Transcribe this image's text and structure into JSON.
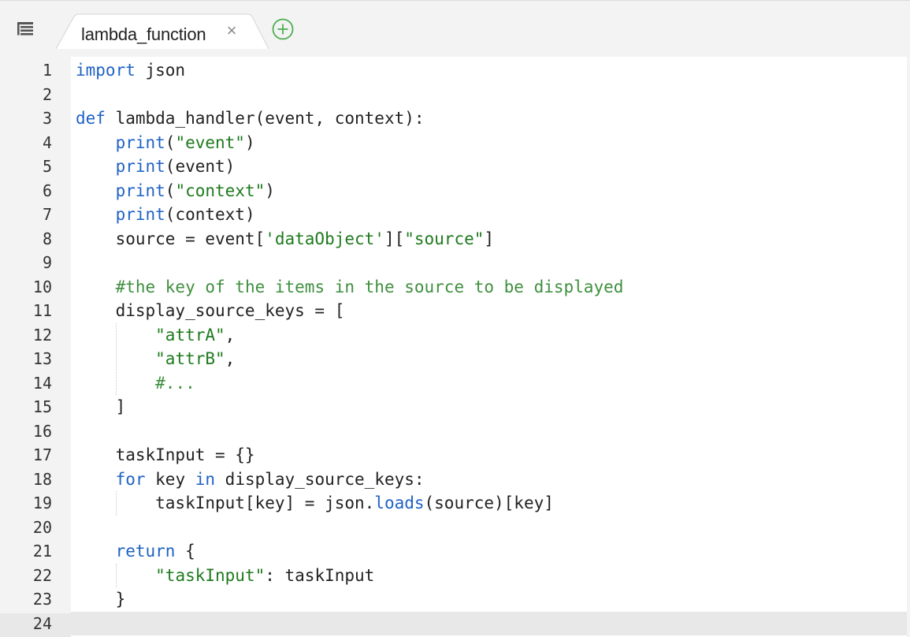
{
  "tab": {
    "filename": "lambda_function",
    "close_symbol": "×"
  },
  "icons": {
    "file_tree": "list-icon",
    "add_tab": "plus-circle-icon",
    "close": "close-icon"
  },
  "colors": {
    "keyword": "#1f62c4",
    "string": "#1e7a1e",
    "comment": "#3f8f3f",
    "add_tab_accent": "#4caf50"
  },
  "editor": {
    "active_line": 24,
    "lines": [
      {
        "n": "1",
        "tokens": [
          [
            "kw",
            "import"
          ],
          [
            "txt",
            " json"
          ]
        ]
      },
      {
        "n": "2",
        "tokens": []
      },
      {
        "n": "3",
        "tokens": [
          [
            "kw",
            "def"
          ],
          [
            "txt",
            " lambda_handler(event, context):"
          ]
        ]
      },
      {
        "n": "4",
        "tokens": [
          [
            "txt",
            "    "
          ],
          [
            "fn",
            "print"
          ],
          [
            "txt",
            "("
          ],
          [
            "str",
            "\"event\""
          ],
          [
            "txt",
            ")"
          ]
        ]
      },
      {
        "n": "5",
        "tokens": [
          [
            "txt",
            "    "
          ],
          [
            "fn",
            "print"
          ],
          [
            "txt",
            "(event)"
          ]
        ]
      },
      {
        "n": "6",
        "tokens": [
          [
            "txt",
            "    "
          ],
          [
            "fn",
            "print"
          ],
          [
            "txt",
            "("
          ],
          [
            "str",
            "\"context\""
          ],
          [
            "txt",
            ")"
          ]
        ]
      },
      {
        "n": "7",
        "tokens": [
          [
            "txt",
            "    "
          ],
          [
            "fn",
            "print"
          ],
          [
            "txt",
            "(context)"
          ]
        ]
      },
      {
        "n": "8",
        "tokens": [
          [
            "txt",
            "    source = event["
          ],
          [
            "str",
            "'dataObject'"
          ],
          [
            "txt",
            "]["
          ],
          [
            "str",
            "\"source\""
          ],
          [
            "txt",
            "]"
          ]
        ]
      },
      {
        "n": "9",
        "tokens": []
      },
      {
        "n": "10",
        "tokens": [
          [
            "txt",
            "    "
          ],
          [
            "cmt",
            "#the key of the items in the source to be displayed"
          ]
        ]
      },
      {
        "n": "11",
        "tokens": [
          [
            "txt",
            "    display_source_keys = ["
          ]
        ]
      },
      {
        "n": "12",
        "tokens": [
          [
            "txt",
            "        "
          ],
          [
            "str",
            "\"attrA\""
          ],
          [
            "txt",
            ","
          ]
        ]
      },
      {
        "n": "13",
        "tokens": [
          [
            "txt",
            "        "
          ],
          [
            "str",
            "\"attrB\""
          ],
          [
            "txt",
            ","
          ]
        ]
      },
      {
        "n": "14",
        "tokens": [
          [
            "txt",
            "        "
          ],
          [
            "cmt",
            "#..."
          ]
        ]
      },
      {
        "n": "15",
        "tokens": [
          [
            "txt",
            "    ]"
          ]
        ]
      },
      {
        "n": "16",
        "tokens": []
      },
      {
        "n": "17",
        "tokens": [
          [
            "txt",
            "    taskInput = {}"
          ]
        ]
      },
      {
        "n": "18",
        "tokens": [
          [
            "txt",
            "    "
          ],
          [
            "kw",
            "for"
          ],
          [
            "txt",
            " key "
          ],
          [
            "kw",
            "in"
          ],
          [
            "txt",
            " display_source_keys:"
          ]
        ]
      },
      {
        "n": "19",
        "tokens": [
          [
            "txt",
            "        taskInput[key] = json."
          ],
          [
            "fn",
            "loads"
          ],
          [
            "txt",
            "(source)[key]"
          ]
        ]
      },
      {
        "n": "20",
        "tokens": []
      },
      {
        "n": "21",
        "tokens": [
          [
            "txt",
            "    "
          ],
          [
            "kw",
            "return"
          ],
          [
            "txt",
            " {"
          ]
        ]
      },
      {
        "n": "22",
        "tokens": [
          [
            "txt",
            "        "
          ],
          [
            "str",
            "\"taskInput\""
          ],
          [
            "txt",
            ": taskInput"
          ]
        ]
      },
      {
        "n": "23",
        "tokens": [
          [
            "txt",
            "    }"
          ]
        ]
      },
      {
        "n": "24",
        "tokens": []
      }
    ]
  }
}
